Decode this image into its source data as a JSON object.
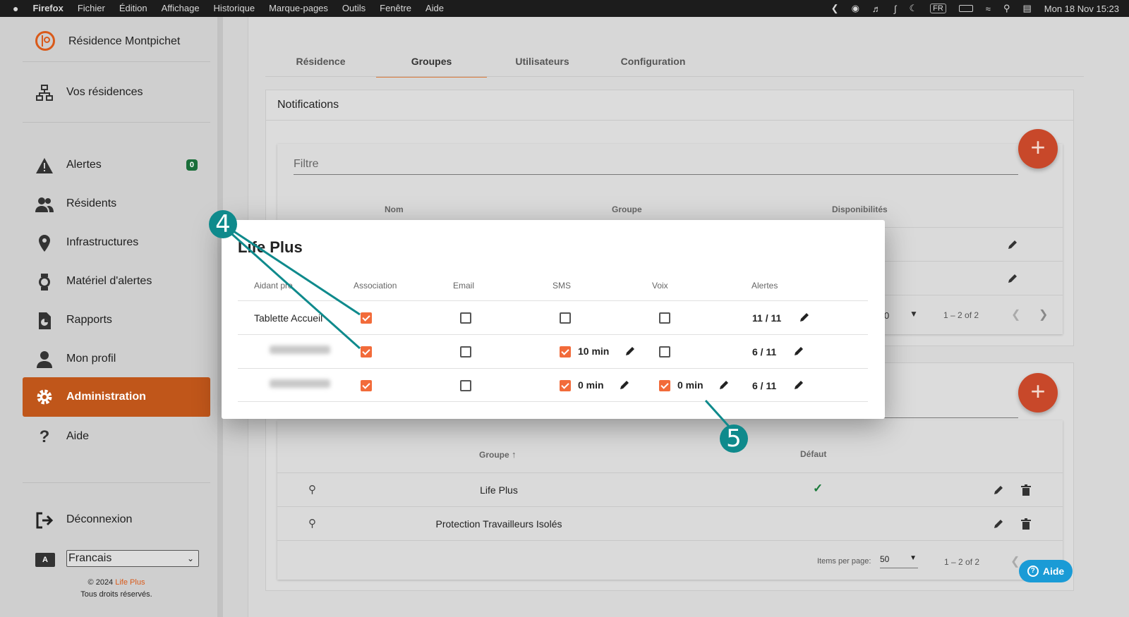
{
  "menubar": {
    "apple": "",
    "app": "Firefox",
    "items": [
      "Fichier",
      "Édition",
      "Affichage",
      "Historique",
      "Marque-pages",
      "Outils",
      "Fenêtre",
      "Aide"
    ],
    "input_source": "FR",
    "datetime": "Mon 18 Nov  15:23"
  },
  "sidebar": {
    "residence": "Résidence Montpichet",
    "vos_residences": "Vos résidences",
    "items": [
      {
        "label": "Alertes",
        "icon": "warning-icon",
        "badge": "0"
      },
      {
        "label": "Résidents",
        "icon": "people-icon"
      },
      {
        "label": "Infrastructures",
        "icon": "location-pin-icon"
      },
      {
        "label": "Matériel d'alertes",
        "icon": "watch-icon"
      },
      {
        "label": "Rapports",
        "icon": "report-icon"
      },
      {
        "label": "Mon profil",
        "icon": "person-icon"
      },
      {
        "label": "Administration",
        "icon": "gear-icon"
      },
      {
        "label": "Aide",
        "icon": "question-icon"
      }
    ],
    "logout": "Déconnexion",
    "language": "Francais",
    "copyright_prefix": "© 2024 ",
    "copyright_brand": "Life Plus",
    "rights": "Tous droits réservés.",
    "brand_color": "#c0561a"
  },
  "tabs": [
    "Résidence",
    "Groupes",
    "Utilisateurs",
    "Configuration"
  ],
  "active_tab": "Groupes",
  "notifications": {
    "title": "Notifications",
    "filter_placeholder": "Filtre",
    "columns": [
      "Nom",
      "Groupe",
      "Disponibilités"
    ],
    "pagination": {
      "page_size_partial": "0",
      "range": "1 – 2 of 2"
    }
  },
  "groups_table": {
    "columns": [
      "Groupe",
      "Défaut"
    ],
    "rows": [
      {
        "name": "Life Plus",
        "default": true
      },
      {
        "name": "Protection Travailleurs Isolés",
        "default": false
      }
    ],
    "pagination": {
      "label": "Items per page:",
      "page_size": "50",
      "range": "1 – 2 of 2"
    }
  },
  "modal": {
    "title": "Life Plus",
    "columns": [
      "Aidant pro",
      "Association",
      "Email",
      "SMS",
      "Voix",
      "Alertes"
    ],
    "rows": [
      {
        "name": "Tablette Accueil",
        "association": true,
        "email": false,
        "sms": false,
        "sms_delay": "",
        "voice": false,
        "voice_delay": "",
        "alerts": "11 / 11"
      },
      {
        "name": "",
        "association": true,
        "email": false,
        "sms": true,
        "sms_delay": "10 min",
        "voice": false,
        "voice_delay": "",
        "alerts": "6 / 11"
      },
      {
        "name": "",
        "association": true,
        "email": false,
        "sms": true,
        "sms_delay": "0 min",
        "voice": true,
        "voice_delay": "0 min",
        "alerts": "6 / 11"
      }
    ]
  },
  "callouts": [
    "4",
    "5"
  ],
  "help_button": "Aide",
  "colors": {
    "accent": "#f26b3a",
    "fab": "#c8482a",
    "callout": "#0f8a8c",
    "help": "#1a9bd6",
    "success": "#1a7a3a"
  }
}
